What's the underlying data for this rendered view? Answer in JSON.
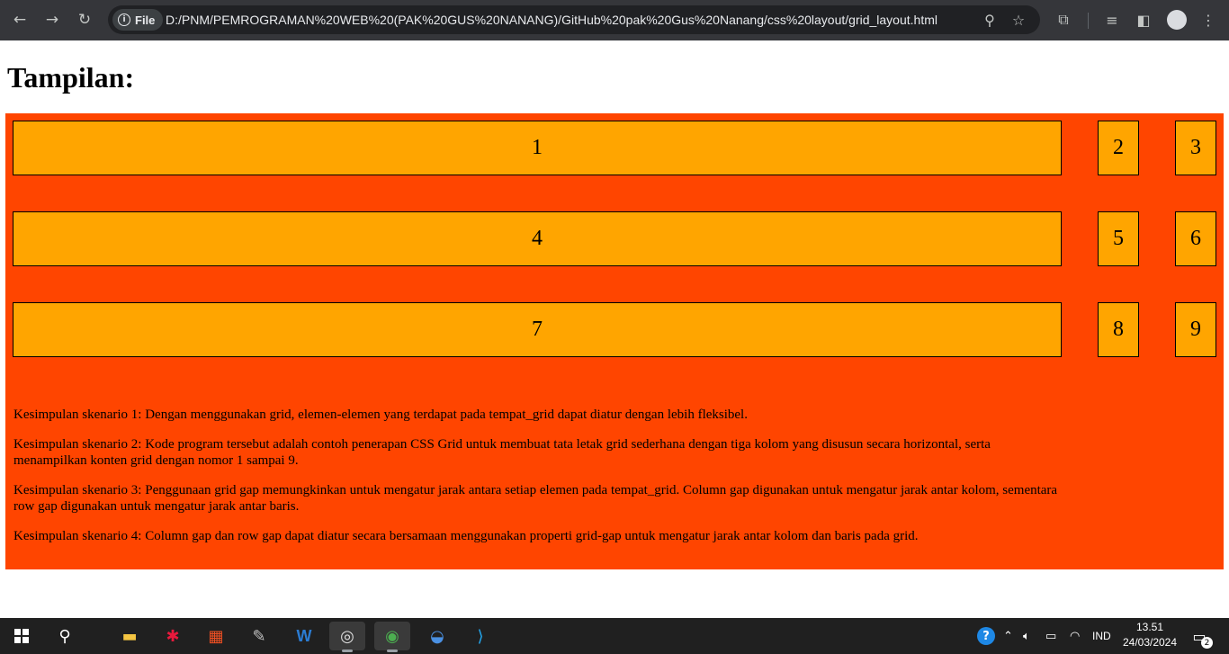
{
  "browser": {
    "back_icon": "arrow-left-icon",
    "forward_icon": "arrow-right-icon",
    "reload_icon": "reload-icon",
    "chip_label": "File",
    "url": "D:/PNM/PEMROGRAMAN%20WEB%20(PAK%20GUS%20NANANG)/GitHub%20pak%20Gus%20Nanang/css%20layout/grid_layout.html",
    "icons": [
      "zoom-icon",
      "star-icon",
      "extensions-icon",
      "media-queue-icon",
      "side-panel-icon",
      "profile-icon",
      "menu-icon"
    ]
  },
  "page": {
    "heading": "Tampilan:",
    "grid_items": [
      "1",
      "2",
      "3",
      "4",
      "5",
      "6",
      "7",
      "8",
      "9"
    ],
    "conclusions": [
      "Kesimpulan skenario 1: Dengan menggunakan grid, elemen-elemen yang terdapat pada tempat_grid dapat diatur dengan lebih fleksibel.",
      "Kesimpulan skenario 2: Kode program tersebut adalah contoh penerapan CSS Grid untuk membuat tata letak grid sederhana dengan tiga kolom yang disusun secara horizontal, serta menampilkan konten grid dengan nomor 1 sampai 9.",
      "Kesimpulan skenario 3: Penggunaan grid gap memungkinkan untuk mengatur jarak antara setiap elemen pada tempat_grid. Column gap digunakan untuk mengatur jarak antar kolom, sementara row gap digunakan untuk mengatur jarak antar baris.",
      "Kesimpulan skenario 4: Column gap dan row gap dapat diatur secara bersamaan menggunakan properti grid-gap untuk mengatur jarak antar kolom dan baris pada grid."
    ],
    "colors": {
      "container_bg": "#ff4500",
      "cell_bg": "#ffa500"
    }
  },
  "taskbar": {
    "apps": [
      "start-icon",
      "search-icon",
      "file-explorer-icon",
      "app-icon",
      "store-icon",
      "app-icon",
      "word-icon",
      "app-icon",
      "chrome-icon",
      "app-icon",
      "vscode-icon"
    ],
    "language": "IND",
    "time": "13.51",
    "date": "24/03/2024",
    "notification_count": "2"
  }
}
